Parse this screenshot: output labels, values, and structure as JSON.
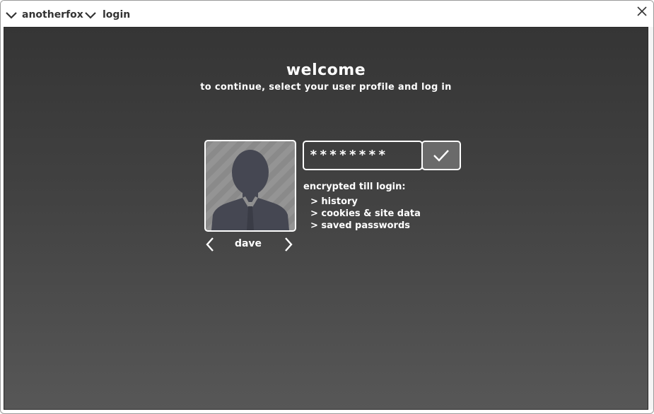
{
  "titlebar": {
    "app_menu_label": "anotherfox",
    "page_menu_label": "login",
    "close_icon": "close-icon"
  },
  "login": {
    "heading": "welcome",
    "subheading": "to continue, select your user profile and log in",
    "profile": {
      "username": "dave",
      "avatar_icon": "user-silhouette-icon",
      "prev_icon": "chevron-left-icon",
      "next_icon": "chevron-right-icon"
    },
    "password": {
      "value": "********",
      "masked": true
    },
    "submit_icon": "checkmark-icon",
    "encrypted": {
      "title": "encrypted till login:",
      "items": [
        "> history",
        "> cookies & site data",
        "> saved passwords"
      ]
    }
  },
  "colors": {
    "background_top": "#353535",
    "background_bottom": "#575757",
    "foreground": "#ffffff",
    "avatar_silhouette": "#454752",
    "submit_button": "#6a6a6a"
  }
}
